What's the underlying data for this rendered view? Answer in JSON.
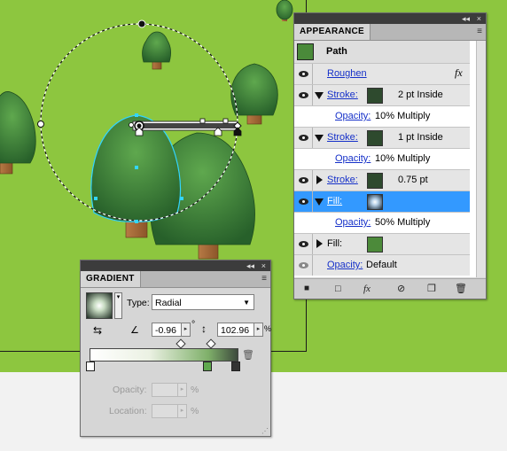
{
  "colors": {
    "canvas_green": "#8dc63f",
    "tree_dark": "#2f6a2c",
    "tree_light": "#5aa34a",
    "selection_blue": "#3399ff",
    "link_blue": "#1530c9"
  },
  "appearance": {
    "tab_label": "APPEARANCE",
    "header_label": "Path",
    "rows": [
      {
        "label": "Roughen",
        "kind": "effect",
        "fx": "fx"
      },
      {
        "label": "Stroke:",
        "value": "2 pt  Inside",
        "kind": "stroke"
      },
      {
        "label": "Opacity:",
        "value": "10% Multiply",
        "kind": "opacity"
      },
      {
        "label": "Stroke:",
        "value": "1 pt  Inside",
        "kind": "stroke"
      },
      {
        "label": "Opacity:",
        "value": "10% Multiply",
        "kind": "opacity"
      },
      {
        "label": "Stroke:",
        "value": "0.75 pt",
        "kind": "stroke"
      },
      {
        "label": "Fill:",
        "value": "",
        "kind": "fill",
        "selected": true
      },
      {
        "label": "Opacity:",
        "value": "50% Multiply",
        "kind": "opacity"
      },
      {
        "label": "Fill:",
        "value": "",
        "kind": "fill"
      },
      {
        "label": "Opacity:",
        "value": "Default",
        "kind": "opacity"
      }
    ],
    "bottom_icons": [
      "add-new-stroke-icon",
      "add-new-fill-icon",
      "fx-icon",
      "clear-appearance-icon",
      "duplicate-item-icon",
      "trash-icon"
    ]
  },
  "gradient": {
    "tab_label": "GRADIENT",
    "type_label": "Type:",
    "type_value": "Radial",
    "angle_value": "-0.96",
    "degree_symbol": "°",
    "aspect_value": "102.96",
    "percent_symbol": "%",
    "opacity_label": "Opacity:",
    "location_label": "Location:"
  },
  "window_controls": {
    "collapse": "◂◂",
    "close": "×",
    "menu": "≡"
  }
}
